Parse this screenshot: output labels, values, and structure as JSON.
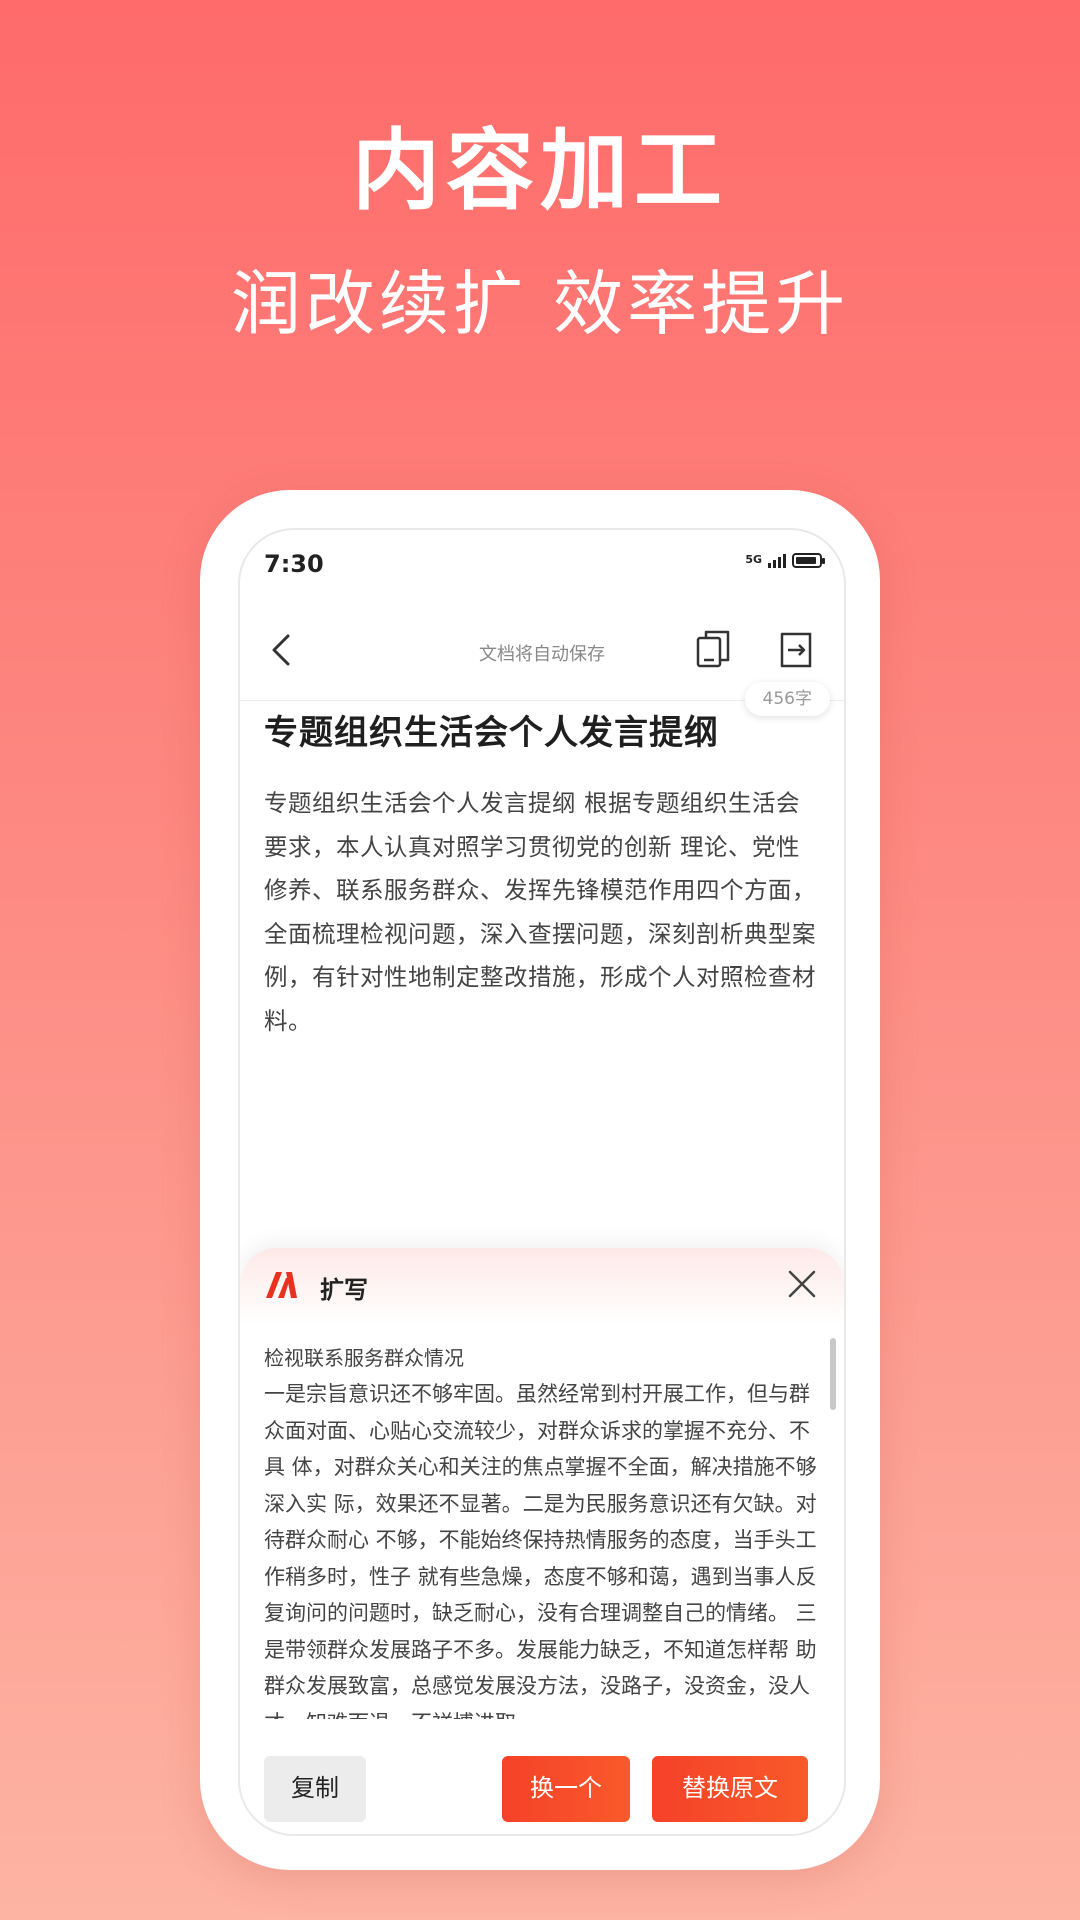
{
  "promo": {
    "headline": "内容加工",
    "subline": "润改续扩  效率提升"
  },
  "status_bar": {
    "time": "7:30",
    "network": "5G",
    "icons": [
      "signal-icon",
      "battery-icon"
    ]
  },
  "nav": {
    "back_icon": "back-chevron-icon",
    "title": "文档将自动保存",
    "copy_icon": "copy-document-icon",
    "export_icon": "export-icon"
  },
  "document": {
    "word_count": "456字",
    "title": "专题组织生活会个人发言提纲",
    "body": "专题组织生活会个人发言提纲 根据专题组织生活会要求，本人认真对照学习贯彻党的创新 理论、党性修养、联系服务群众、发挥先锋模范作用四个方面， 全面梳理检视问题，深入查摆问题，深刻剖析典型案例，有针对性地制定整改措施，形成个人对照检查材料。"
  },
  "panel": {
    "logo_icon": "app-logo-icon",
    "title": "扩写",
    "close_icon": "close-icon",
    "subtitle": "检视联系服务群众情况",
    "text": "一是宗旨意识还不够牢固。虽然经常到村开展工作，但与群 众面对面、心贴心交流较少，对群众诉求的掌握不充分、不具 体，对群众关心和关注的焦点掌握不全面，解决措施不够深入实 际，效果还不显著。二是为民服务意识还有欠缺。对待群众耐心 不够，不能始终保持热情服务的态度，当手头工作稍多时，性子 就有些急燥，态度不够和蔼，遇到当事人反复询问的问题时，缺乏耐心，没有合理调整自己的情绪。 三是带领群众发展路子不多。发展能力缺乏，不知道怎样帮 助群众发展致富，总感觉发展没方法，没路子，没资金，没人才，知难而退，不祥博进取。",
    "buttons": {
      "copy": "复制",
      "change": "换一个",
      "replace": "替换原文"
    }
  },
  "colors": {
    "accent": "#f6412a",
    "background_top": "#fe6b6a",
    "background_bottom": "#fdb4a3"
  }
}
